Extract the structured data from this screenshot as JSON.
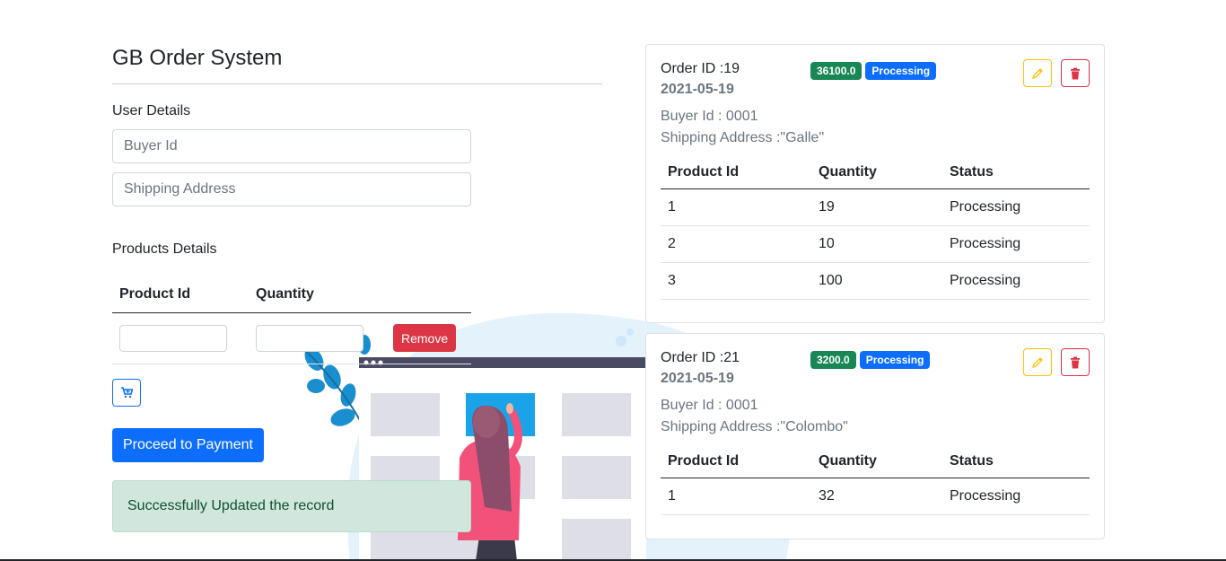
{
  "app": {
    "title": "GB Order System"
  },
  "form": {
    "user_details_label": "User Details",
    "buyer_placeholder": "Buyer Id",
    "shipping_placeholder": "Shipping Address",
    "products_details_label": "Products Details",
    "product_table": {
      "headers": [
        "Product Id",
        "Quantity"
      ],
      "remove_label": "Remove"
    },
    "cart_icon": "cart-plus-icon",
    "proceed_label": "Proceed to Payment",
    "alert_text": "Successfully Updated the record"
  },
  "orders": [
    {
      "order_id": "Order ID :19",
      "date": "2021-05-19",
      "total_badge": "36100.0",
      "status_badge": "Processing",
      "buyer": "Buyer Id : 0001",
      "shipping": "Shipping Address :\"Galle\"",
      "headers": [
        "Product Id",
        "Quantity",
        "Status"
      ],
      "rows": [
        [
          "1",
          "19",
          "Processing"
        ],
        [
          "2",
          "10",
          "Processing"
        ],
        [
          "3",
          "100",
          "Processing"
        ]
      ]
    },
    {
      "order_id": "Order ID :21",
      "date": "2021-05-19",
      "total_badge": "3200.0",
      "status_badge": "Processing",
      "buyer": "Buyer Id : 0001",
      "shipping": "Shipping Address :\"Colombo\"",
      "headers": [
        "Product Id",
        "Quantity",
        "Status"
      ],
      "rows": [
        [
          "1",
          "32",
          "Processing"
        ]
      ]
    }
  ],
  "colors": {
    "primary": "#0d6efd",
    "danger": "#dc3545",
    "success": "#198754",
    "warning": "#ffc107",
    "alert_bg": "#d1e7dd"
  }
}
